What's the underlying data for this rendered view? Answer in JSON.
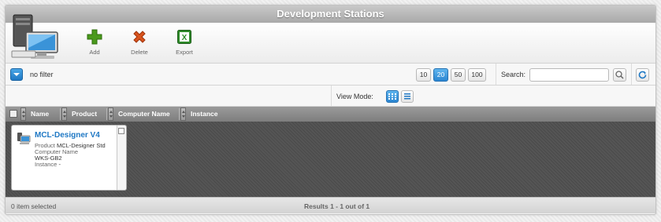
{
  "window": {
    "title": "Development Stations"
  },
  "toolbar": {
    "add_label": "Add",
    "delete_label": "Delete",
    "export_label": "Export",
    "export_glyph": "X",
    "add_color": "#4a9a1c",
    "delete_color": "#d9541e",
    "export_color": "#2f8b2a"
  },
  "filter": {
    "label": "no filter"
  },
  "pagination": {
    "sizes": [
      "10",
      "20",
      "50",
      "100"
    ],
    "active": "20"
  },
  "search": {
    "label": "Search:",
    "value": ""
  },
  "view_mode": {
    "label": "View Mode:",
    "active": "grid"
  },
  "columns": [
    "Name",
    "Product",
    "Computer Name",
    "Instance"
  ],
  "cards": [
    {
      "title": "MCL-Designer V4",
      "product_label": "Product",
      "product_value": "MCL-Designer Std",
      "computer_label": "Computer Name",
      "computer_value": "WKS-GB2",
      "instance_label": "Instance",
      "instance_value": "-"
    }
  ],
  "status": {
    "selected": "0 item selected",
    "results": "Results 1 - 1 out of 1"
  },
  "colors": {
    "accent": "#1f78c4",
    "header": "#8c8c8c"
  }
}
